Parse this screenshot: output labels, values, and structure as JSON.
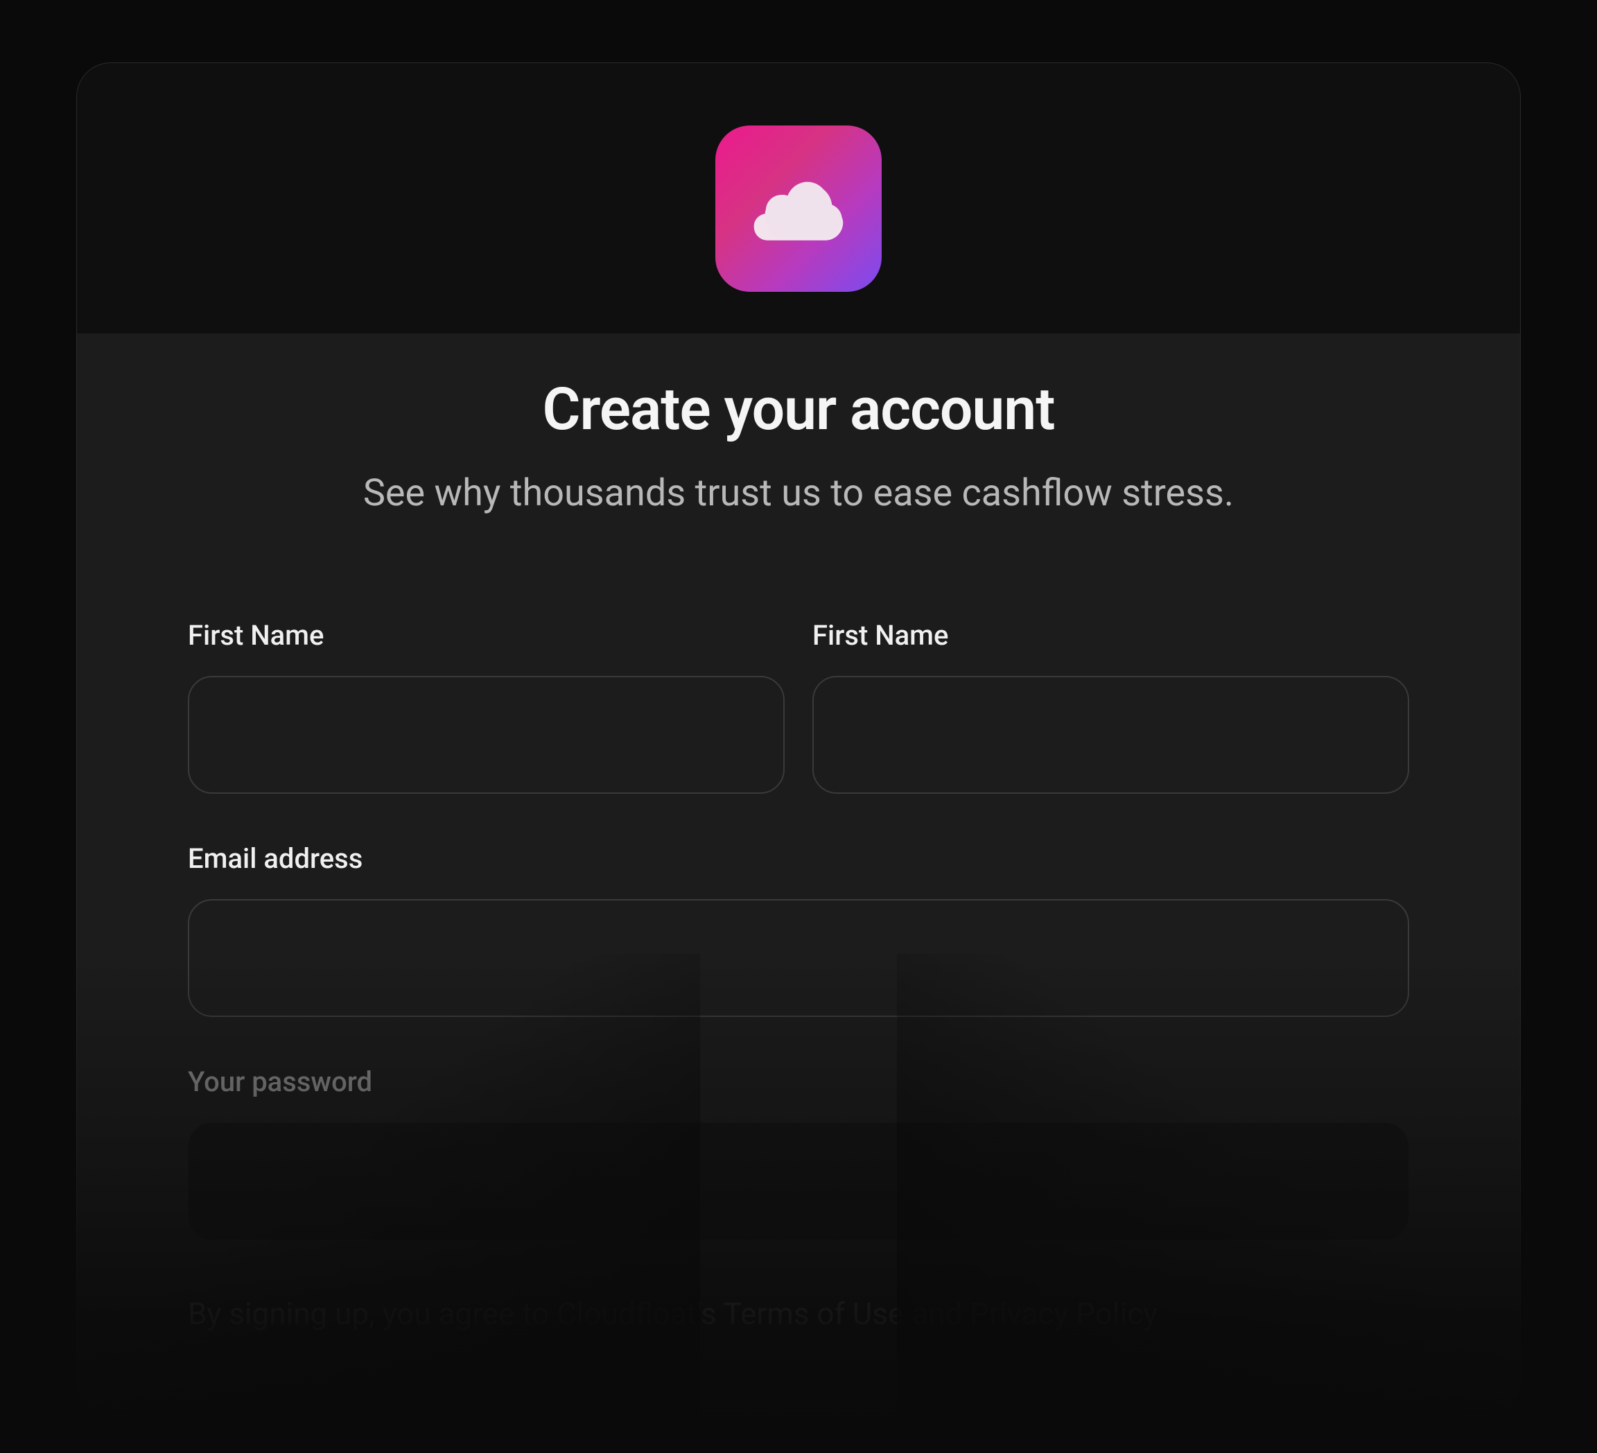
{
  "header": {
    "title": "Create your account",
    "subtitle": "See why thousands trust us to ease cashflow stress."
  },
  "form": {
    "first_name_label_left": "First Name",
    "first_name_value_left": "",
    "first_name_label_right": "First Name",
    "first_name_value_right": "",
    "email_label": "Email address",
    "email_value": "",
    "password_label": "Your password",
    "password_value": ""
  },
  "terms": {
    "prefix": "By signing up, you agree to Cloudfloat's ",
    "terms_link": "Terms of Use",
    "and": " and ",
    "privacy_link": "Privacy Policy"
  },
  "brand": {
    "name": "Cloudfloat",
    "logo_gradient_start": "#ec1a8d",
    "logo_gradient_end": "#7b4bf0"
  }
}
